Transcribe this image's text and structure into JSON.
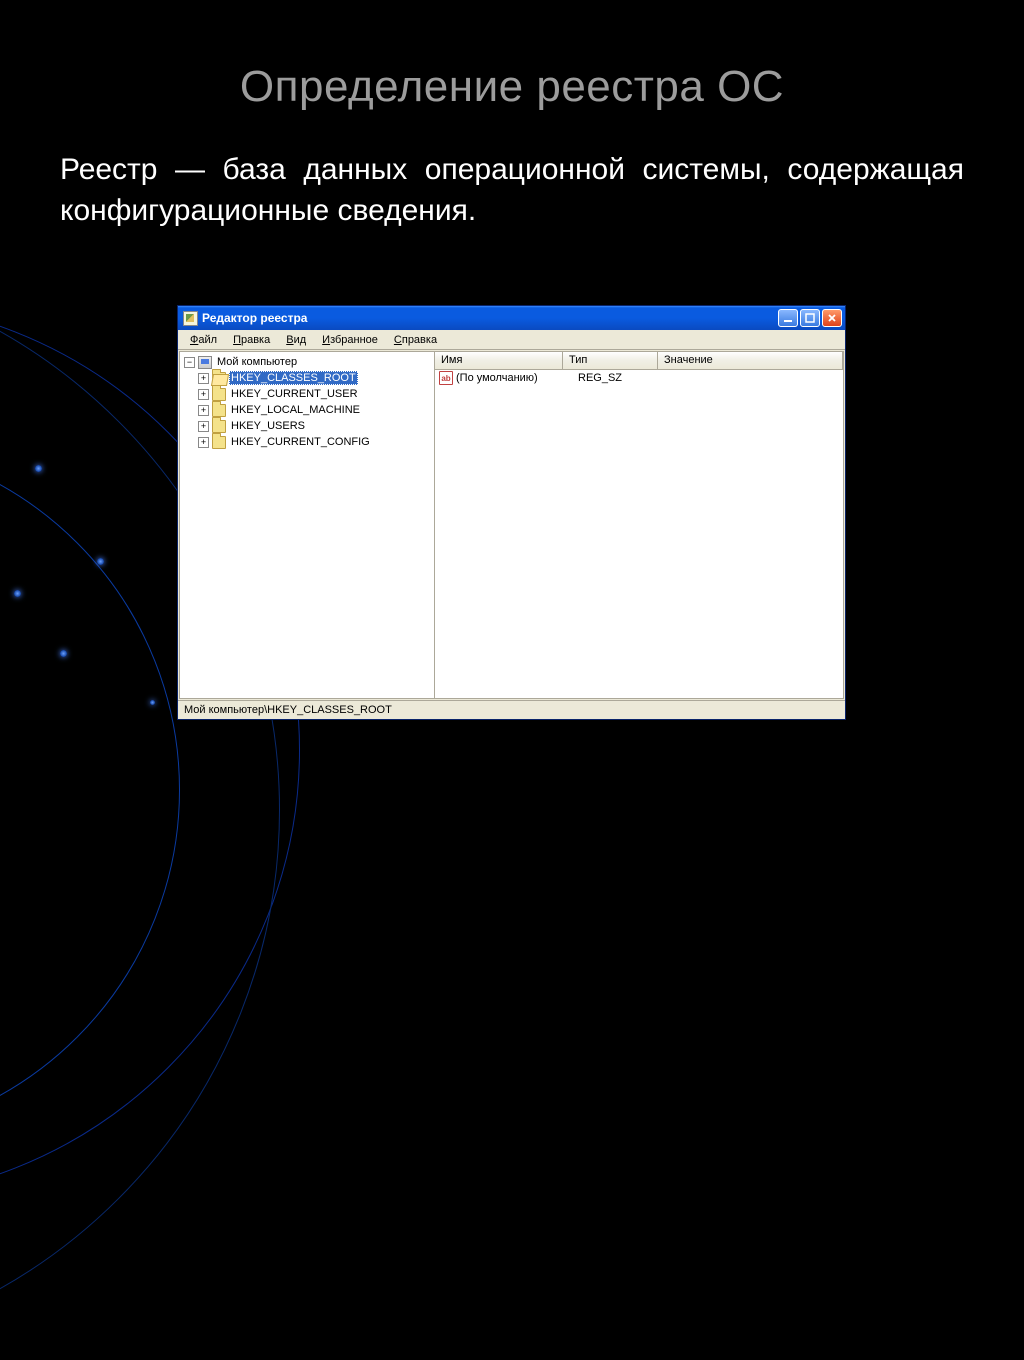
{
  "slide": {
    "title": "Определение реестра ОС",
    "body": "Реестр — база данных операционной системы, содержащая конфигурационные сведения."
  },
  "window": {
    "title": "Редактор реестра",
    "menu": [
      "Файл",
      "Правка",
      "Вид",
      "Избранное",
      "Справка"
    ],
    "tree": {
      "root": "Мой компьютер",
      "keys": [
        "HKEY_CLASSES_ROOT",
        "HKEY_CURRENT_USER",
        "HKEY_LOCAL_MACHINE",
        "HKEY_USERS",
        "HKEY_CURRENT_CONFIG"
      ],
      "selected_index": 0
    },
    "list": {
      "columns": [
        "Имя",
        "Тип",
        "Значение"
      ],
      "rows": [
        {
          "name": "(По умолчанию)",
          "type": "REG_SZ",
          "value": ""
        }
      ]
    },
    "statusbar": "Мой компьютер\\HKEY_CLASSES_ROOT",
    "buttons": {
      "minimize": "_",
      "maximize": "□",
      "close": "×"
    }
  }
}
